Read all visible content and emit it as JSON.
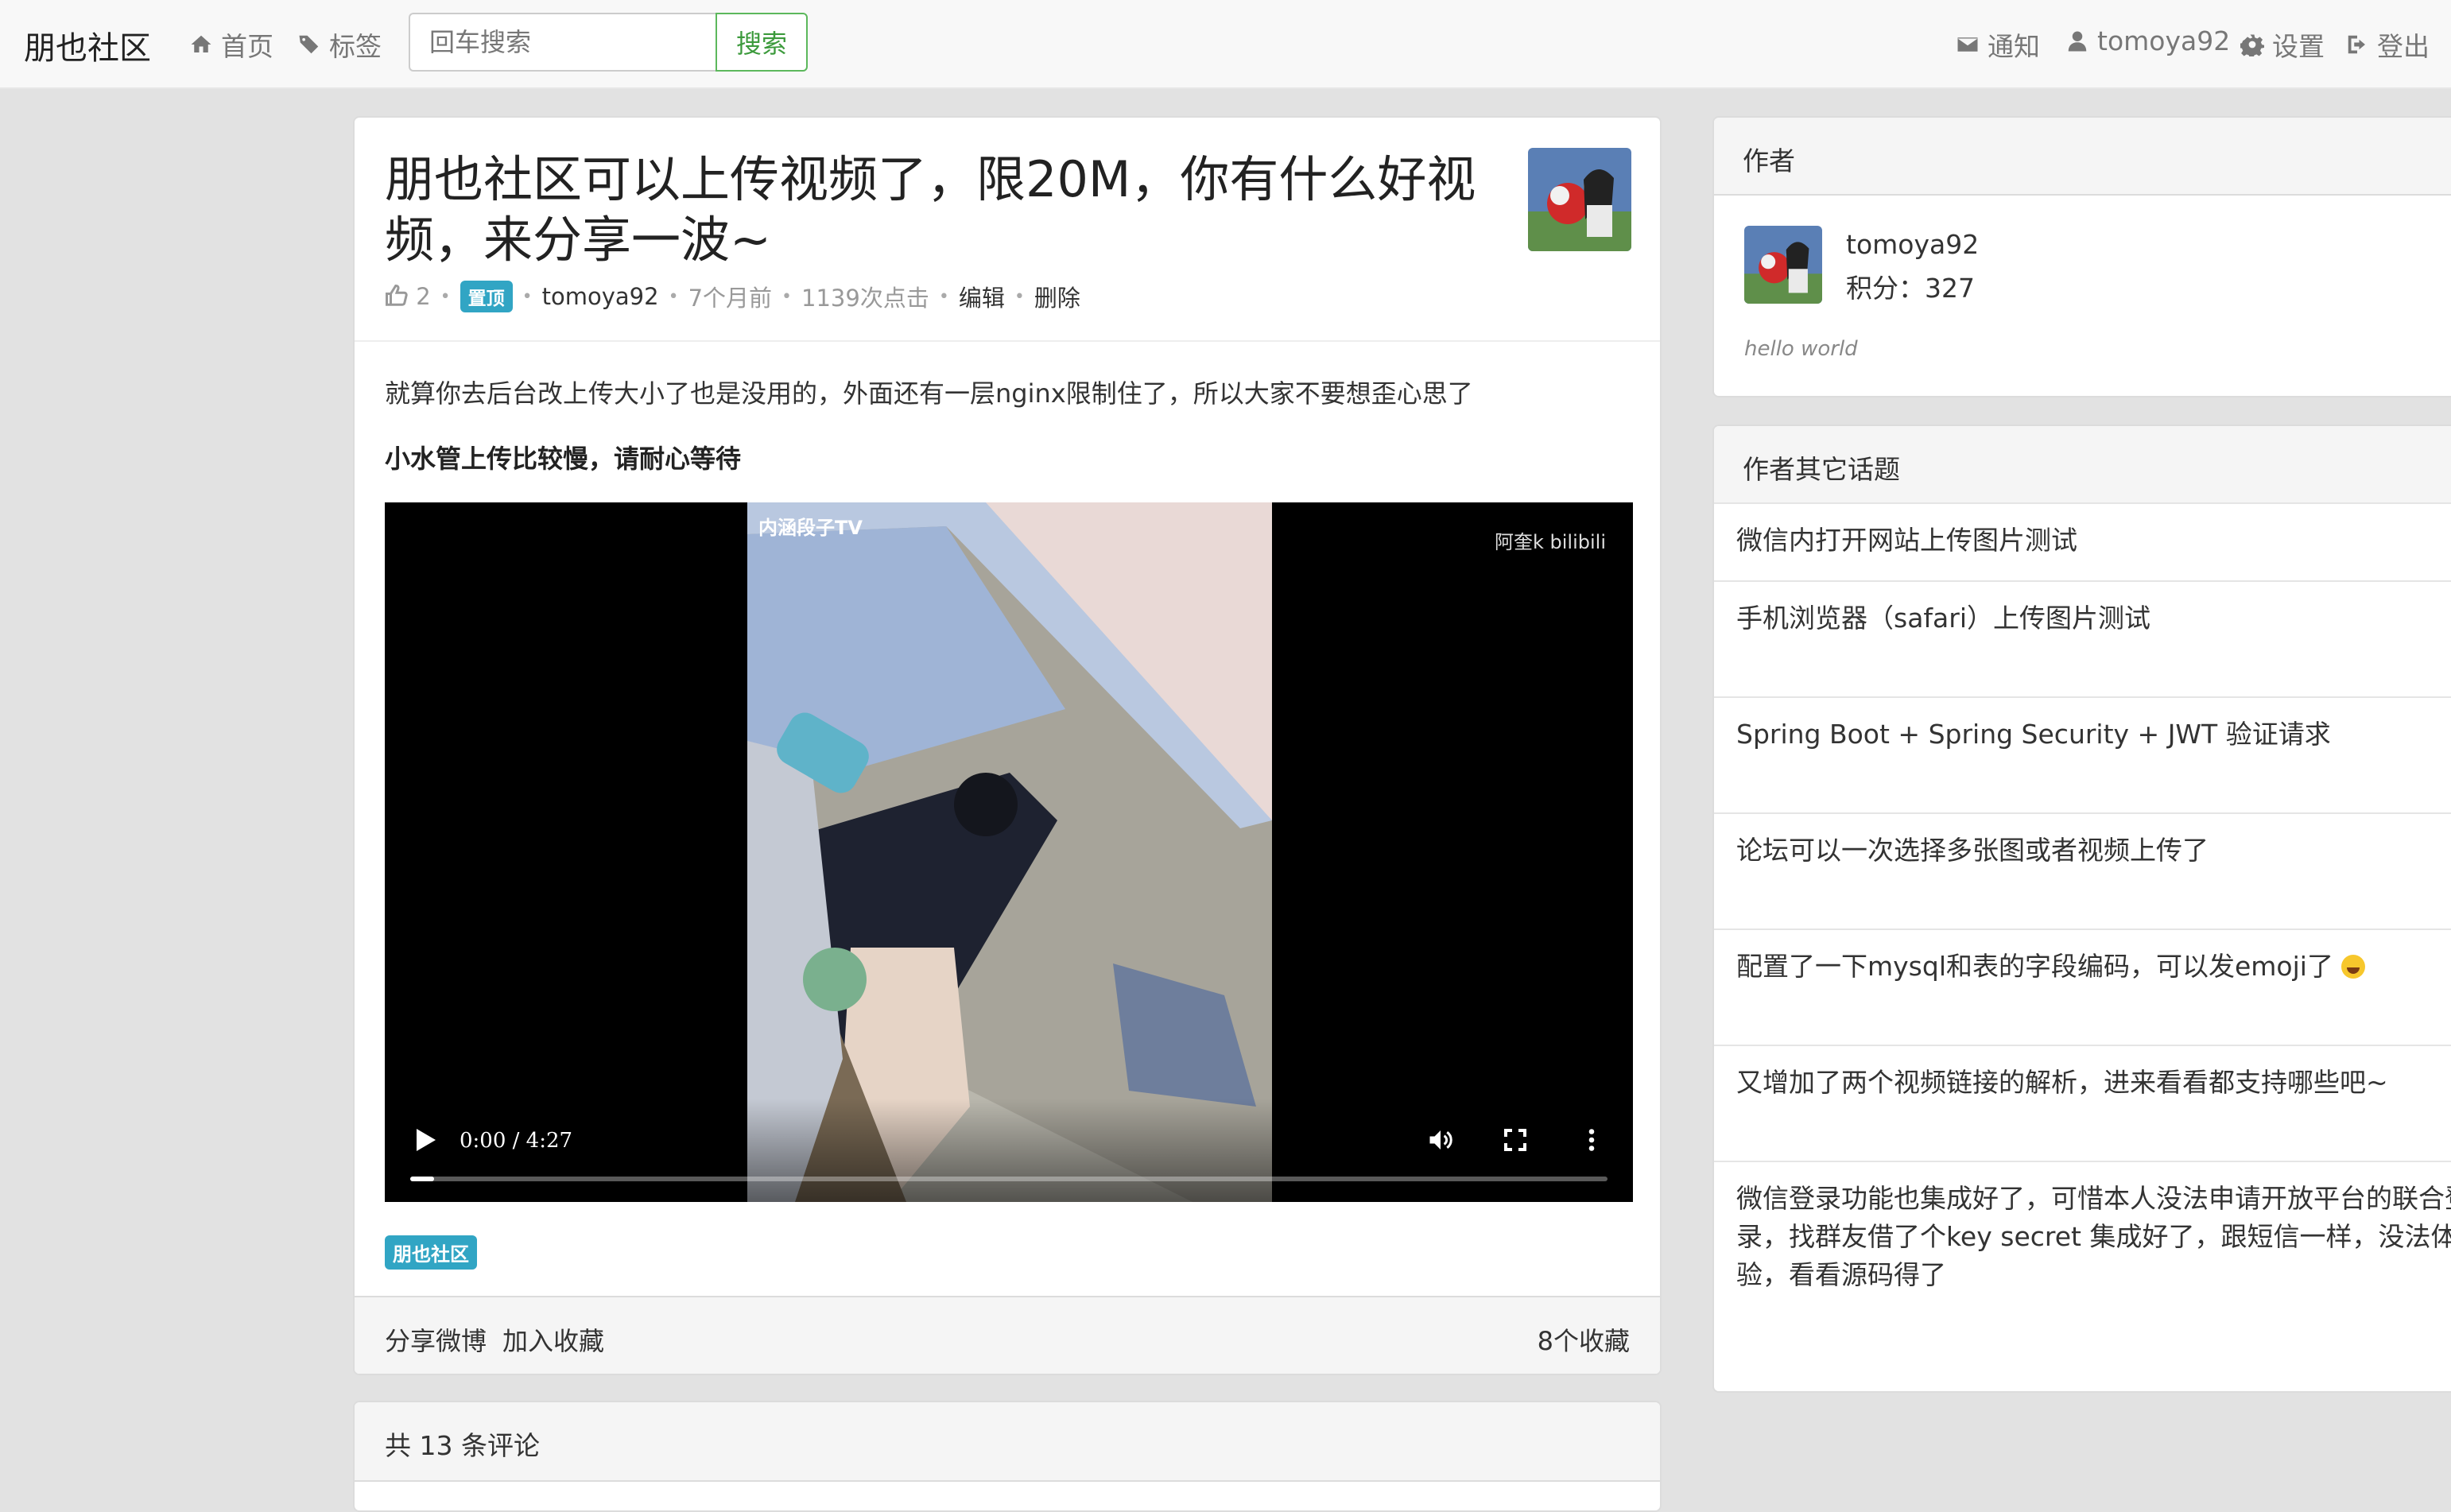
{
  "navbar": {
    "brand": "朋也社区",
    "home": "首页",
    "tags": "标签",
    "search_placeholder": "回车搜索",
    "search_button": "搜索",
    "notifications": "通知",
    "username": "tomoya92",
    "settings": "设置",
    "logout": "登出"
  },
  "topic": {
    "title": "朋也社区可以上传视频了，限20M，你有什么好视频，来分享一波~",
    "likes": "2",
    "pinned_badge": "置顶",
    "author": "tomoya92",
    "time": "7个月前",
    "views": "1139次点击",
    "edit": "编辑",
    "delete": "删除",
    "content_line1": "就算你去后台改上传大小了也是没用的，外面还有一层nginx限制住了，所以大家不要想歪心思了",
    "content_line2": "小水管上传比较慢，请耐心等待",
    "video": {
      "watermark_left": "内涵段子TV",
      "watermark_right": "阿奎k bilibili",
      "time_display": "0:00 / 4:27",
      "progress": 0.02
    },
    "tag": "朋也社区",
    "share_weibo": "分享微博",
    "add_favorite": "加入收藏",
    "favorites_count": "8个收藏"
  },
  "comments": {
    "header": "共 13 条评论"
  },
  "sidebar": {
    "author_heading": "作者",
    "author_name": "tomoya92",
    "author_score": "积分：327",
    "author_bio": "hello world",
    "other_heading": "作者其它话题",
    "other_topics": [
      "微信内打开网站上传图片测试",
      "手机浏览器（safari）上传图片测试",
      "Spring Boot + Spring Security + JWT 验证请求",
      "论坛可以一次选择多张图或者视频上传了",
      "配置了一下mysql和表的字段编码，可以发emoji了",
      "又增加了两个视频链接的解析，进来看看都支持哪些吧~",
      "微信登录功能也集成好了，可惜本人没法申请开放平台的联合登录，找群友借了个key secret 集成好了，跟短信一样，没法体验，看看源码得了"
    ]
  },
  "icons": {
    "home": "home-icon",
    "tags": "tags-icon",
    "notifications": "envelope-icon",
    "user": "user-icon",
    "settings": "gear-icon",
    "logout": "sign-out-icon",
    "like": "thumbs-up-icon"
  }
}
